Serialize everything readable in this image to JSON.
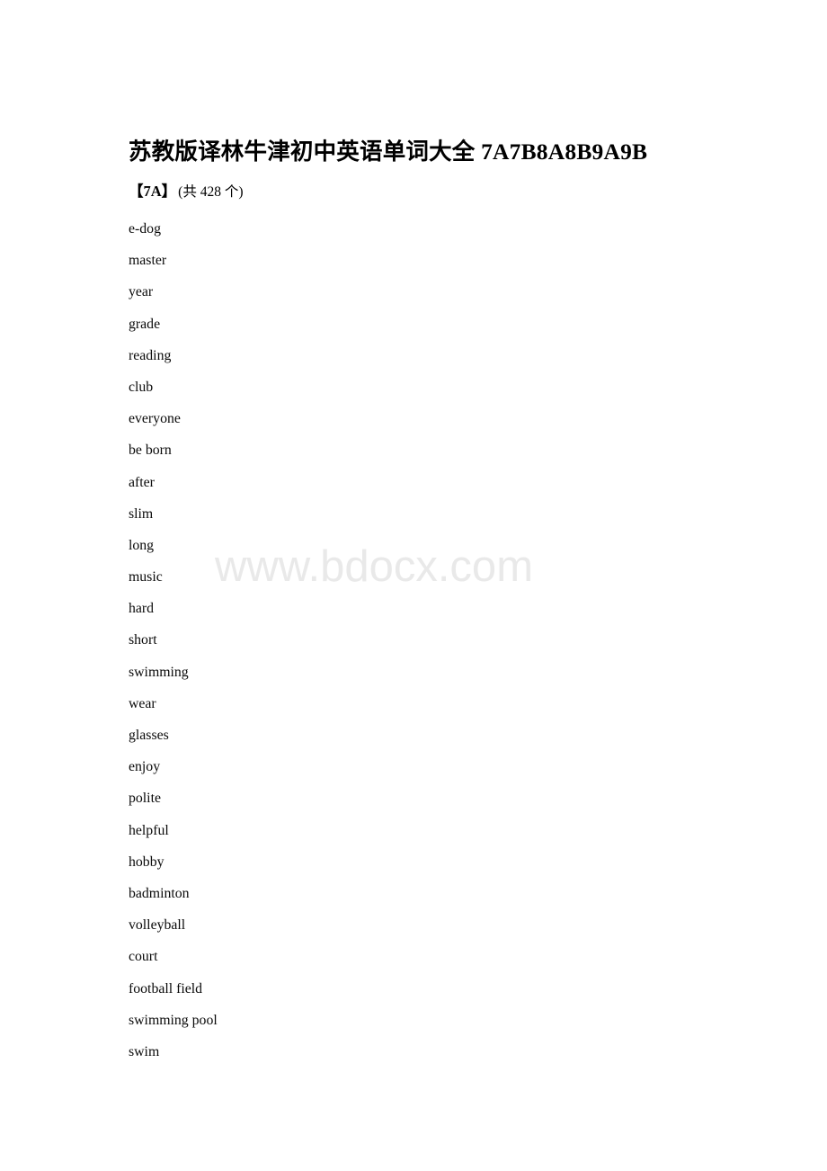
{
  "document": {
    "title_cn": "苏教版译林牛津初中英语单词大全 ",
    "title_code": "7A7B8A8B9A9B",
    "section_label": "【7A】",
    "section_count": "(共 428 个)",
    "watermark": "www.bdocx.com",
    "words": [
      "e-dog",
      "master",
      "year",
      "grade",
      "reading",
      "club",
      "everyone",
      "be born",
      "after",
      "slim",
      "long",
      "music",
      "hard",
      "short",
      "swimming",
      "wear",
      "glasses",
      "enjoy",
      "polite",
      "helpful",
      "hobby",
      "badminton",
      "volleyball",
      "court",
      "football field",
      "swimming pool",
      "swim"
    ]
  }
}
